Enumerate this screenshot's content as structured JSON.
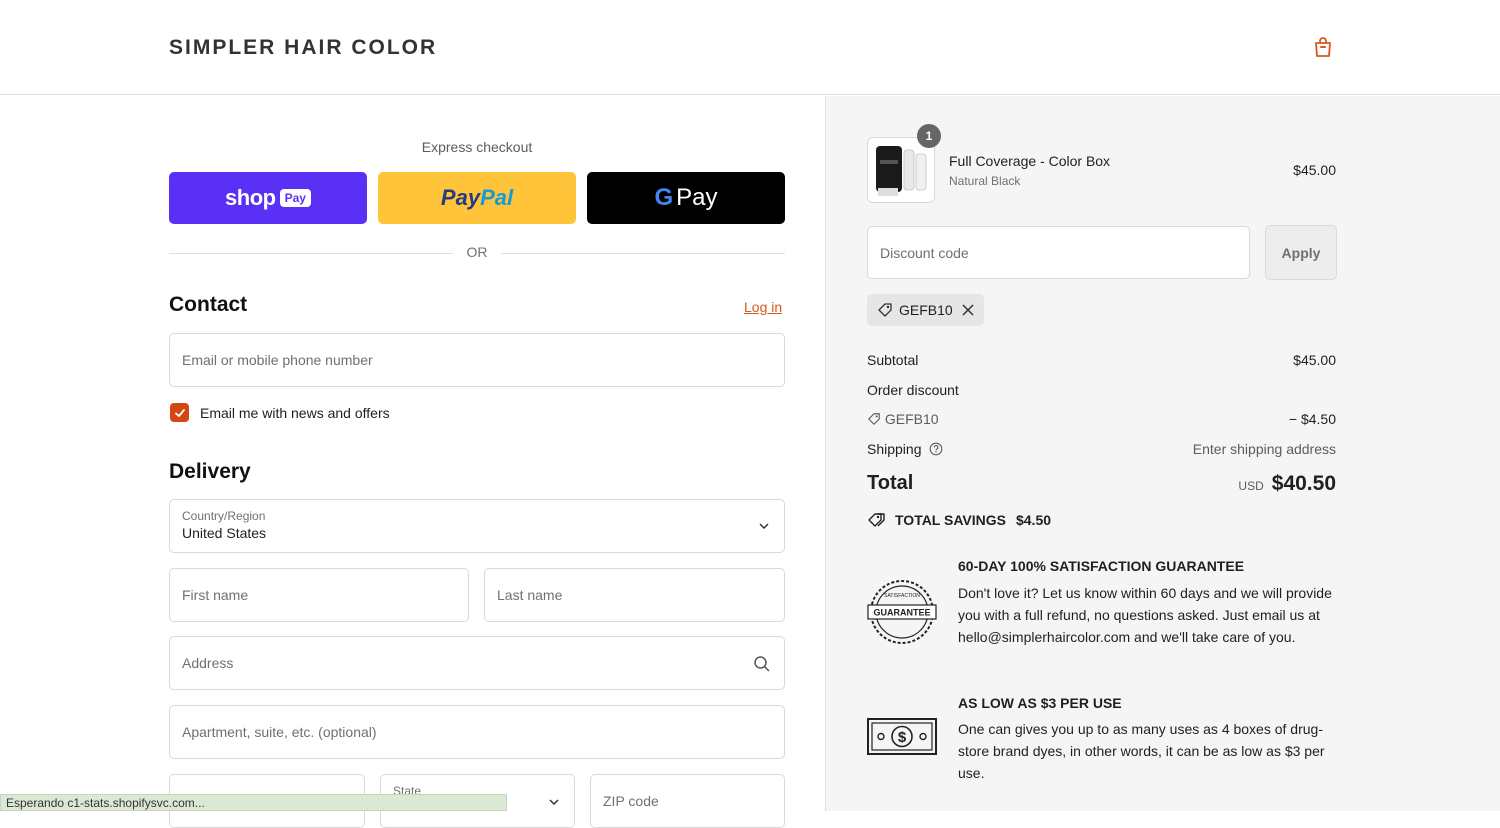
{
  "header": {
    "brand": "SIMPLER HAIR COLOR",
    "cart_icon": "shopping-bag-icon",
    "accent": "#d45a1a"
  },
  "express": {
    "label": "Express checkout",
    "shop_pay": {
      "word": "shop",
      "pill": "Pay",
      "color": "#5a31f4"
    },
    "paypal": {
      "pay": "Pay",
      "pal": "Pal",
      "color": "#ffc439"
    },
    "gpay": {
      "g": "G",
      "text": "Pay",
      "color": "#000000"
    },
    "or": "OR"
  },
  "contact": {
    "title": "Contact",
    "login": "Log in",
    "email_placeholder": "Email or mobile phone number",
    "news_checkbox_label": "Email me with news and offers",
    "news_checked": true
  },
  "delivery": {
    "title": "Delivery",
    "country_label": "Country/Region",
    "country_value": "United States",
    "first_name_placeholder": "First name",
    "last_name_placeholder": "Last name",
    "address_placeholder": "Address",
    "apartment_placeholder": "Apartment, suite, etc. (optional)",
    "state_label": "State",
    "zip_placeholder": "ZIP code"
  },
  "status_bar": "Esperando c1-stats.shopifysvc.com...",
  "summary": {
    "product": {
      "name": "Full Coverage - Color Box",
      "variant": "Natural Black",
      "price": "$45.00",
      "quantity": "1"
    },
    "discount_placeholder": "Discount code",
    "apply_label": "Apply",
    "applied_code": "GEFB10",
    "subtotal_label": "Subtotal",
    "subtotal_value": "$45.00",
    "order_discount_label": "Order discount",
    "discount_code": "GEFB10",
    "discount_value": "− $4.50",
    "shipping_label": "Shipping",
    "shipping_value": "Enter shipping address",
    "total_label": "Total",
    "currency": "USD",
    "total_value": "$40.50",
    "savings_label": "TOTAL SAVINGS",
    "savings_value": "$4.50"
  },
  "trust": {
    "guarantee_title": "60-DAY 100% SATISFACTION GUARANTEE",
    "guarantee_text": "Don't love it? Let us know within 60 days and we will provide you with a full refund, no questions asked. Just email us at hello@simplerhaircolor.com and we'll take care of you.",
    "guarantee_badge": "GUARANTEE",
    "guarantee_badge_arc": "SATISFACTION",
    "low_title": "AS LOW AS $3 PER USE",
    "low_text": "One can gives you up to as many uses as 4 boxes of drug-store brand dyes, in other words, it can be as low as $3 per use."
  }
}
